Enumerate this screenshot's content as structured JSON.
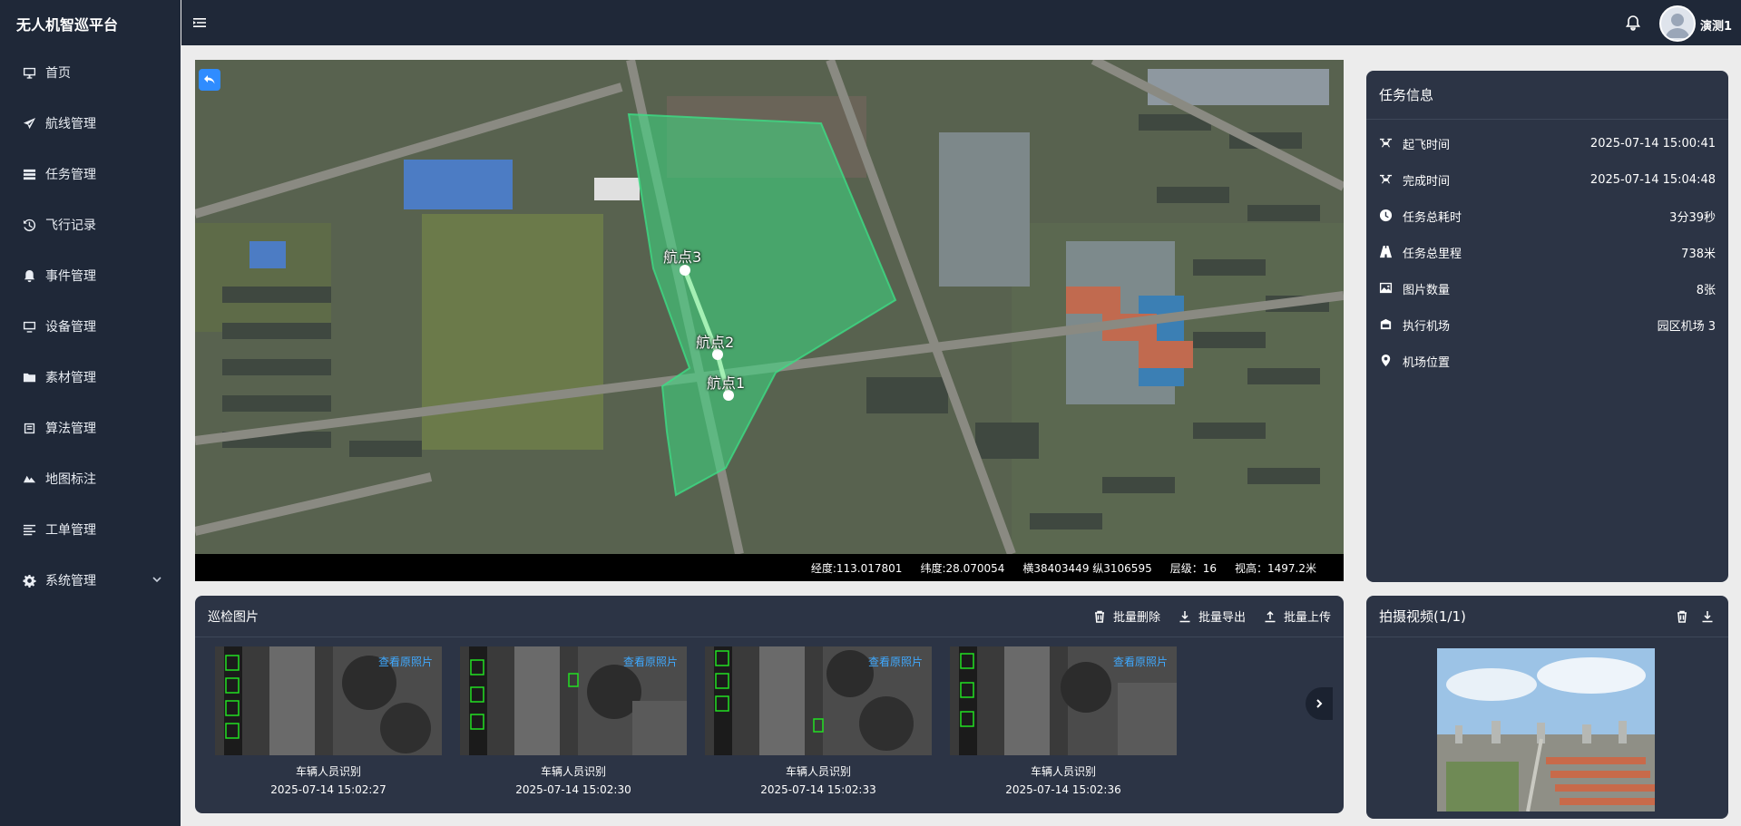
{
  "app": {
    "title": "无人机智巡平台"
  },
  "sidebar": {
    "items": [
      {
        "label": "首页",
        "icon": "monitor-icon"
      },
      {
        "label": "航线管理",
        "icon": "plane-icon"
      },
      {
        "label": "任务管理",
        "icon": "list-icon"
      },
      {
        "label": "飞行记录",
        "icon": "history-icon"
      },
      {
        "label": "事件管理",
        "icon": "bell-icon"
      },
      {
        "label": "设备管理",
        "icon": "desktop-icon"
      },
      {
        "label": "素材管理",
        "icon": "folder-icon"
      },
      {
        "label": "算法管理",
        "icon": "algorithm-icon"
      },
      {
        "label": "地图标注",
        "icon": "map-mark-icon"
      },
      {
        "label": "工单管理",
        "icon": "lines-icon"
      },
      {
        "label": "系统管理",
        "icon": "gear-icon"
      }
    ]
  },
  "header": {
    "username": "演测1"
  },
  "map": {
    "waypoints": [
      {
        "label": "航点3"
      },
      {
        "label": "航点2"
      },
      {
        "label": "航点1"
      }
    ],
    "status": {
      "longitude": "经度:113.017801",
      "latitude": "纬度:28.070054",
      "projected": "横38403449 纵3106595",
      "level": "层级：16",
      "altitude": "视高：1497.2米"
    }
  },
  "task_info": {
    "title": "任务信息",
    "rows": [
      {
        "label": "起飞时间",
        "value": "2025-07-14 15:00:41",
        "icon": "drone-icon"
      },
      {
        "label": "完成时间",
        "value": "2025-07-14 15:04:48",
        "icon": "drone-icon"
      },
      {
        "label": "任务总耗时",
        "value": "3分39秒",
        "icon": "clock-icon"
      },
      {
        "label": "任务总里程",
        "value": "738米",
        "icon": "road-icon"
      },
      {
        "label": "图片数量",
        "value": "8张",
        "icon": "image-icon"
      },
      {
        "label": "执行机场",
        "value": "园区机场 3",
        "icon": "hangar-icon"
      },
      {
        "label": "机场位置",
        "value": "",
        "icon": "location-pin-icon"
      }
    ]
  },
  "inspection": {
    "title": "巡检图片",
    "actions": {
      "delete": "批量删除",
      "export": "批量导出",
      "upload": "批量上传"
    },
    "view_original": "查看原照片",
    "images": [
      {
        "caption": "车辆人员识别",
        "time": "2025-07-14 15:02:27"
      },
      {
        "caption": "车辆人员识别",
        "time": "2025-07-14 15:02:30"
      },
      {
        "caption": "车辆人员识别",
        "time": "2025-07-14 15:02:33"
      },
      {
        "caption": "车辆人员识别",
        "time": "2025-07-14 15:02:36"
      }
    ]
  },
  "video": {
    "title": "拍摄视频(1/1)"
  }
}
